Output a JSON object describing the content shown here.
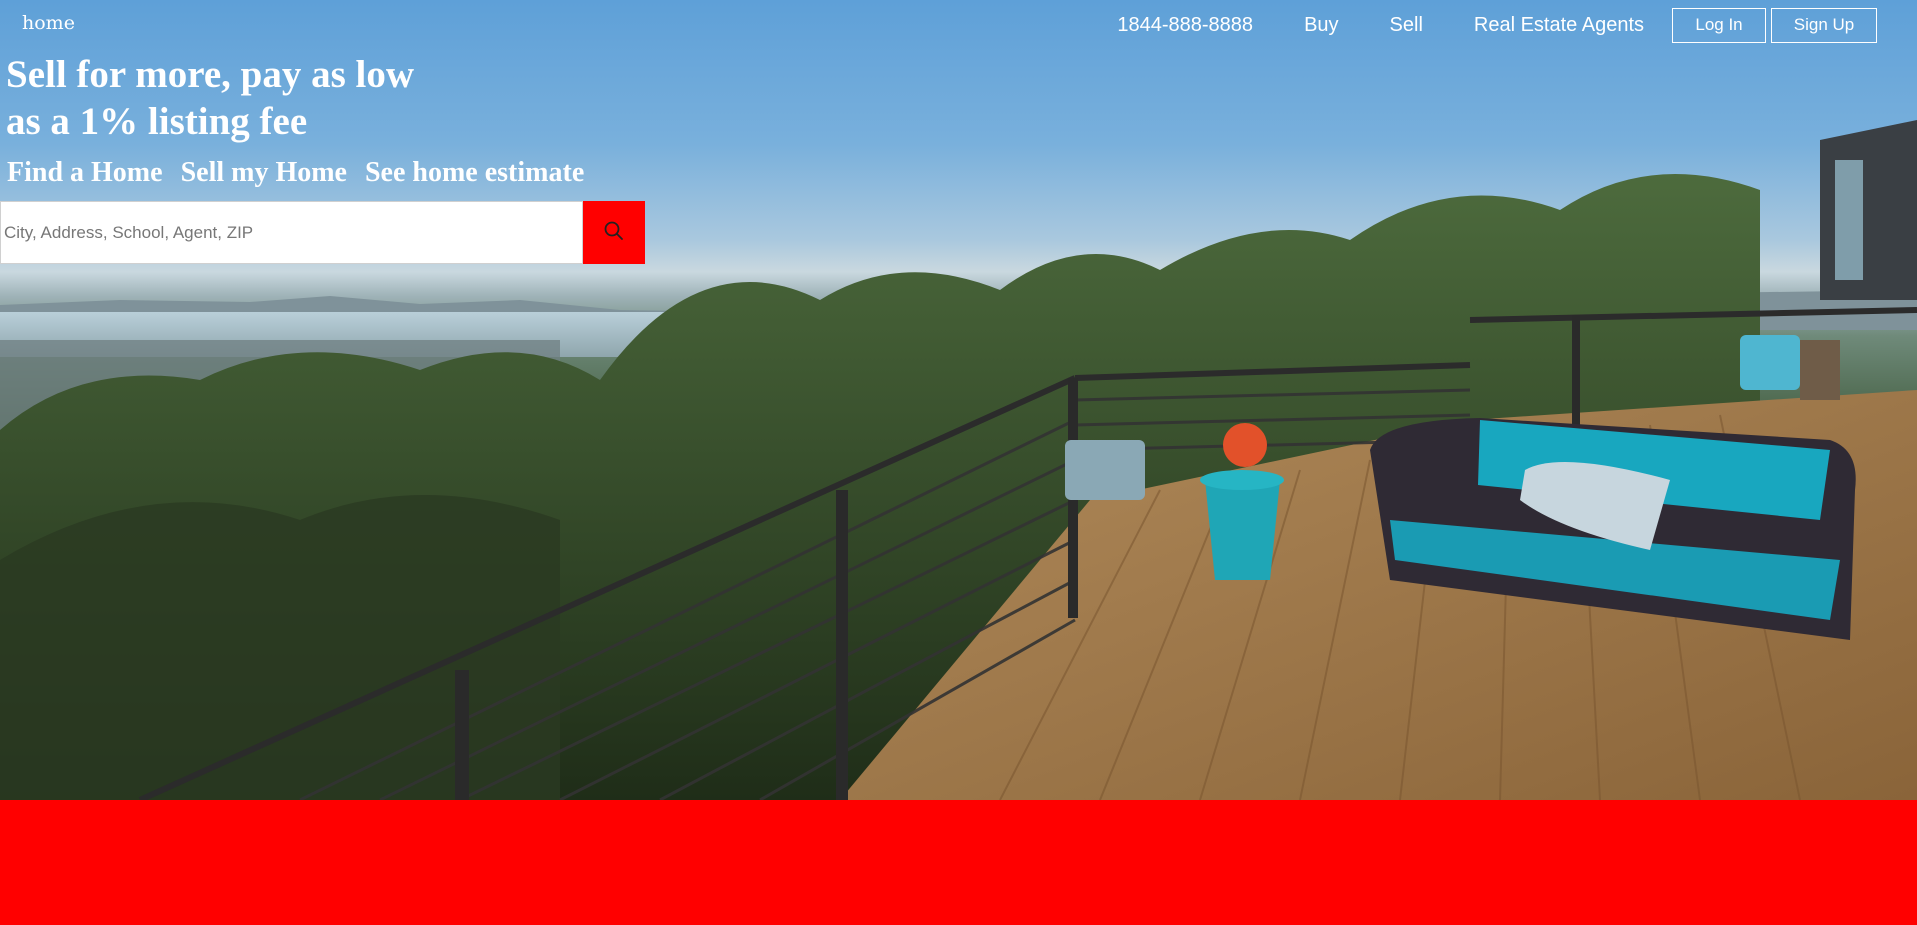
{
  "nav": {
    "brand": "home",
    "phone": "1844-888-8888",
    "links": [
      "Buy",
      "Sell",
      "Real Estate Agents"
    ],
    "login_label": "Log In",
    "signup_label": "Sign Up"
  },
  "hero": {
    "headline_line1": "Sell for more, pay as low",
    "headline_line2": "as a 1% listing fee",
    "tabs": [
      "Find a Home",
      "Sell my Home",
      "See home estimate"
    ],
    "search": {
      "placeholder": "City, Address, School, Agent, ZIP",
      "value": "",
      "button_icon": "search-icon"
    }
  },
  "colors": {
    "accent": "#ff0000",
    "text_on_hero": "#ffffff"
  }
}
